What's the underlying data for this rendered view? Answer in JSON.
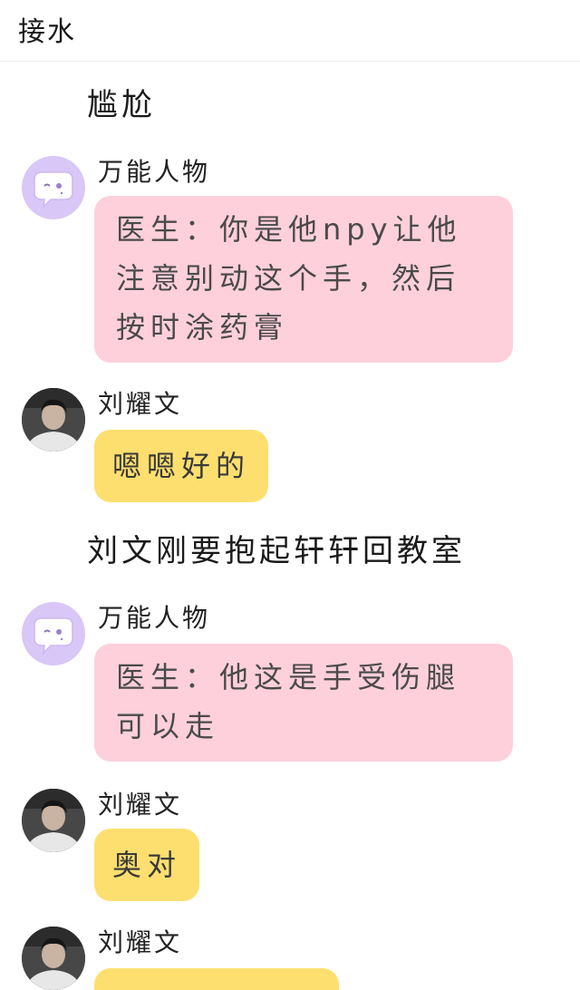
{
  "header": {
    "title": "接水"
  },
  "narrations": [
    "尴尬",
    "刘文刚要抱起轩轩回教室"
  ],
  "messages": [
    {
      "sender": "万能人物",
      "text": "医生：你是他npy让他注意别动这个手，然后按时涂药膏"
    },
    {
      "sender": "刘耀文",
      "text": "嗯嗯好的"
    },
    {
      "sender": "万能人物",
      "text": "医生：他这是手受伤腿可以走"
    },
    {
      "sender": "刘耀文",
      "text": "奥对"
    },
    {
      "sender": "刘耀文",
      "text": ""
    }
  ],
  "colors": {
    "pink_bubble": "#fdd0dc",
    "yellow_bubble": "#fddf6f",
    "bot_avatar": "#d9c7f7"
  },
  "icons": {
    "bot_avatar": "chat-bubble-icon",
    "user_avatar": "profile-photo"
  }
}
